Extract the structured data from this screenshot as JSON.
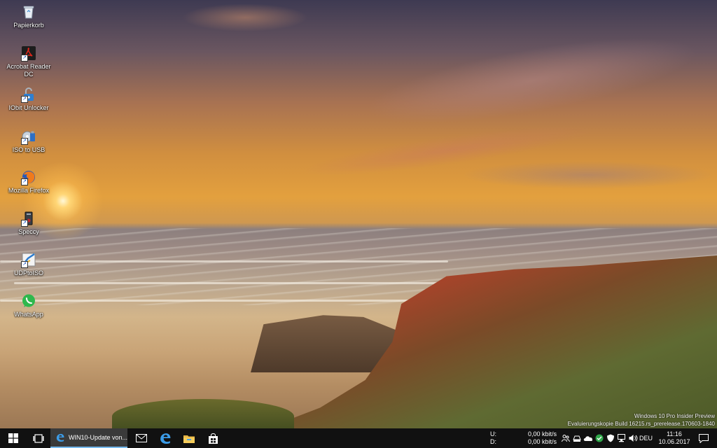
{
  "desktop": {
    "icons": [
      {
        "label": "Papierkorb",
        "icon": "recycle-bin-icon"
      },
      {
        "label": "Acrobat Reader DC",
        "icon": "acrobat-icon"
      },
      {
        "label": "IObit Unlocker",
        "icon": "unlocker-icon"
      },
      {
        "label": "ISO to USB",
        "icon": "iso-usb-icon"
      },
      {
        "label": "Mozilla Firefox",
        "icon": "firefox-icon"
      },
      {
        "label": "Speccy",
        "icon": "speccy-icon"
      },
      {
        "label": "UDPtoISO",
        "icon": "udptoiso-icon"
      },
      {
        "label": "WhatsApp",
        "icon": "whatsapp-icon"
      }
    ],
    "watermark": {
      "line1": "Windows 10 Pro Insider Preview",
      "line2": "Evaluierungskopie Build 16215.rs_prerelease.170603-1840"
    }
  },
  "taskbar": {
    "active_app": {
      "label": "WIN10-Update von...",
      "icon": "edge-icon"
    },
    "pinned": [
      "mail-icon",
      "edge-icon",
      "file-explorer-icon",
      "store-icon"
    ],
    "network": {
      "upload_label": "U:",
      "upload_value": "0,00 kbit/s",
      "download_label": "D:",
      "download_value": "0,00 kbit/s"
    },
    "tray_icons": [
      "people-icon",
      "drive-icon",
      "onedrive-icon",
      "shield-icon",
      "security-icon",
      "network-icon",
      "volume-icon"
    ],
    "language": "DEU",
    "clock": {
      "time": "11:16",
      "date": "10.06.2017"
    }
  },
  "colors": {
    "taskbar": "#111111",
    "active_accent": "#76b9ed"
  }
}
